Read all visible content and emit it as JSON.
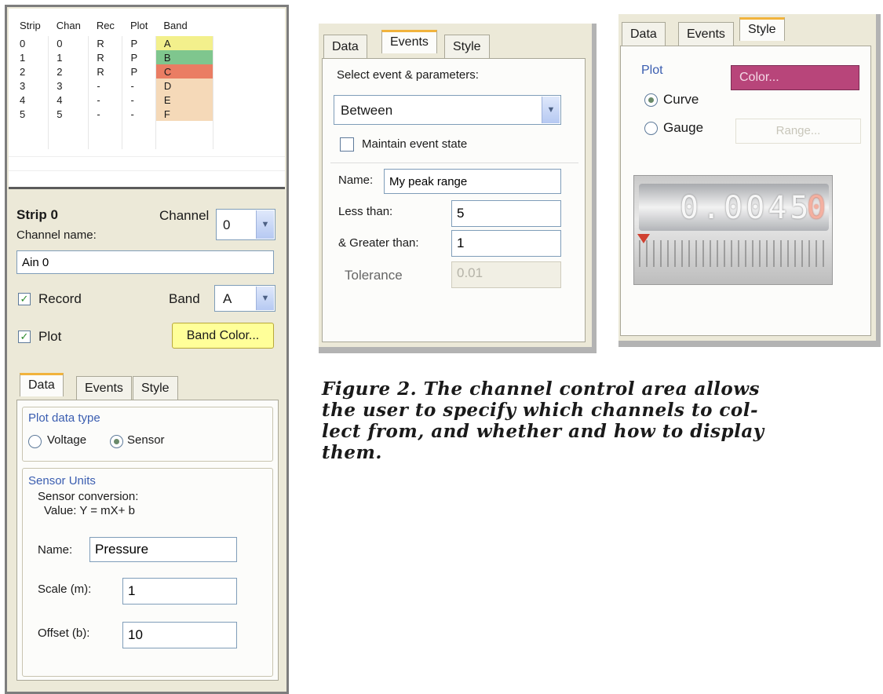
{
  "strip_table": {
    "headers": [
      "Strip",
      "Chan",
      "Rec",
      "Plot",
      "Band"
    ],
    "rows": [
      {
        "strip": "0",
        "chan": "0",
        "rec": "R",
        "plot": "P",
        "band": "A",
        "color": "#f3f08c"
      },
      {
        "strip": "1",
        "chan": "1",
        "rec": "R",
        "plot": "P",
        "band": "B",
        "color": "#7fc68e"
      },
      {
        "strip": "2",
        "chan": "2",
        "rec": "R",
        "plot": "P",
        "band": "C",
        "color": "#ea7d63"
      },
      {
        "strip": "3",
        "chan": "3",
        "rec": "-",
        "plot": "-",
        "band": "D",
        "color": "#f5d9b8"
      },
      {
        "strip": "4",
        "chan": "4",
        "rec": "-",
        "plot": "-",
        "band": "E",
        "color": "#f5d9b8"
      },
      {
        "strip": "5",
        "chan": "5",
        "rec": "-",
        "plot": "-",
        "band": "F",
        "color": "#f5d9b8"
      }
    ]
  },
  "strip_panel": {
    "title": "Strip 0",
    "channel_label": "Channel",
    "channel_value": "0",
    "channel_name_label": "Channel name:",
    "channel_name_value": "Ain 0",
    "record_label": "Record",
    "record_checked": true,
    "band_label": "Band",
    "band_value": "A",
    "plot_label": "Plot",
    "plot_checked": true,
    "band_color_button": "Band Color...",
    "band_color": "#ffff99"
  },
  "tabs": [
    "Data",
    "Events",
    "Style"
  ],
  "data_tab": {
    "plot_type_title": "Plot data type",
    "voltage_label": "Voltage",
    "sensor_label": "Sensor",
    "selected": "Sensor",
    "sensor_units_title": "Sensor Units",
    "conversion_line1": "Sensor conversion:",
    "conversion_line2": "Value: Y = mX+ b",
    "name_label": "Name:",
    "name_value": "Pressure",
    "scale_label": "Scale (m):",
    "scale_value": "1",
    "offset_label": "Offset (b):",
    "offset_value": "10"
  },
  "events_tab": {
    "select_label": "Select event & parameters:",
    "event_value": "Between",
    "maintain_label": "Maintain event state",
    "name_label": "Name:",
    "name_value": "My peak range",
    "less_label": "Less than:",
    "less_value": "5",
    "greater_label": "& Greater than:",
    "greater_value": "1",
    "tolerance_label": "Tolerance",
    "tolerance_value": "0.01"
  },
  "style_tab": {
    "plot_title": "Plot",
    "color_button": "Color...",
    "color": "#b8457a",
    "curve_label": "Curve",
    "gauge_label": "Gauge",
    "selected": "Curve",
    "range_button": "Range...",
    "gauge_digits": "0.0045",
    "gauge_last_digit": "0"
  },
  "caption": {
    "line1": "Figure 2.  The channel control area allows",
    "line2": "the user to specify which channels to col-",
    "line3": "lect from, and whether and how to display",
    "line4": "them."
  },
  "icons": {
    "dropdown": "chevron-down-icon",
    "check": "checkmark-icon"
  }
}
